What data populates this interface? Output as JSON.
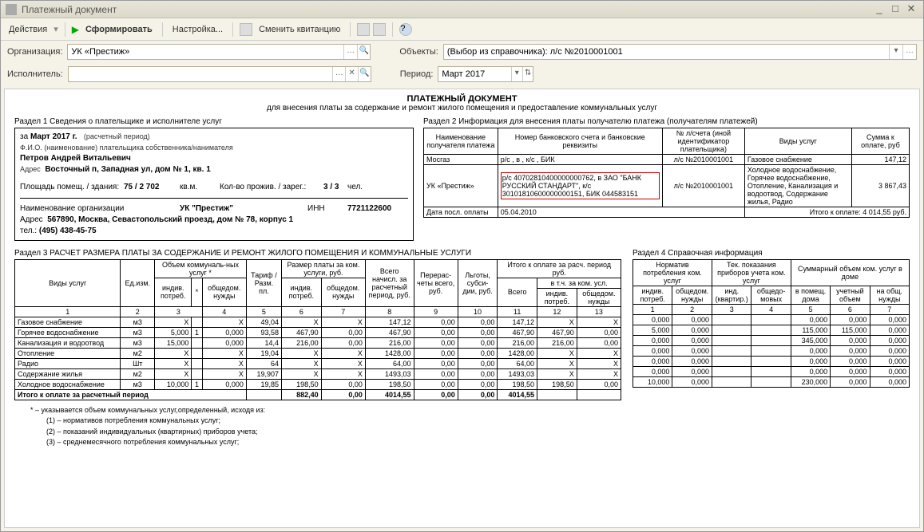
{
  "window": {
    "title": "Платежный документ"
  },
  "toolbar": {
    "actions": "Действия",
    "form": "Сформировать",
    "settings": "Настройка...",
    "change": "Сменить квитанцию"
  },
  "form": {
    "org_label": "Организация:",
    "org_value": "УК «Престиж»",
    "objects_label": "Объекты:",
    "objects_value": "(Выбор из справочника): л/с №2010001001",
    "exec_label": "Исполнитель:",
    "period_label": "Период:",
    "period_value": "Март 2017"
  },
  "doc": {
    "title": "ПЛАТЕЖНЫЙ ДОКУМЕНТ",
    "subtitle": "для внесения платы за содержание и ремонт жилого помещения и предоставление коммунальных услуг"
  },
  "s1": {
    "hdr": "Раздел 1    Сведения о плательщике и исполнителе услуг",
    "period_prefix": "за",
    "period": "Март 2017 г.",
    "period_note": "(расчетный период)",
    "fio_label": "Ф.И.О. (наименование) плательщика собственника/нанимателя",
    "fio": "Петров Андрей Витальевич",
    "addr_label": "Адрес",
    "addr": "Восточный п, Западная ул, дом № 1, кв. 1",
    "area_label": "Площадь помещ. / здания:",
    "area": "75 / 2 702",
    "area_unit": "кв.м.",
    "people_label": "Кол-во прожив. / зарег.:",
    "people": "3 / 3",
    "people_unit": "чел.",
    "org_label": "Наименование организации",
    "org": "УК \"Престиж\"",
    "inn_label": "ИНН",
    "inn": "7721122600",
    "org_addr_label": "Адрес",
    "org_addr": "567890, Москва, Севастопольский проезд, дом № 78, корпус 1",
    "tel_label": "тел.:",
    "tel": "(495) 438-45-75"
  },
  "s2": {
    "hdr": "Раздел 2    Информация для внесения платы получателю платежа (получателям платежей)",
    "cols": [
      "Наименование получателя платежа",
      "Номер банковского счета и банковские реквизиты",
      "№ л/счета (иной идентификатор плательщика)",
      "Виды услуг",
      "Сумма к оплате, руб"
    ],
    "rows": [
      {
        "name": "Мосгаз",
        "bank": "р/с , в , к/с , БИК",
        "acct": "л/с №2010001001",
        "svc": "Газовое снабжение",
        "sum": "147,12"
      },
      {
        "name": "УК «Престиж»",
        "bank": "р/с 40702810400000000762, в ЗАО \"БАНК РУССКИЙ СТАНДАРТ\", к/с 30101810600000000151, БИК 044583151",
        "acct": "л/с №2010001001",
        "svc": "Холодное водоснабжение, Горячее водоснабжение, Отопление, Канализация и водоотвод, Содержание жилья, Радио",
        "sum": "3 867,43"
      }
    ],
    "lastpay_label": "Дата посл. оплаты",
    "lastpay": "05.04.2010",
    "total_label": "Итого к оплате:",
    "total": "4 014,55 руб."
  },
  "s3": {
    "hdr": "Раздел 3    РАСЧЕТ РАЗМЕРА ПЛАТЫ ЗА СОДЕРЖАНИЕ И РЕМОНТ ЖИЛОГО ПОМЕЩЕНИЯ И КОММУНАЛЬНЫЕ УСЛУГИ",
    "head1": [
      "Виды услуг",
      "Ед.изм.",
      "Объем коммуналь-ных услуг *",
      "Тариф / Разм. пл.",
      "Размер платы за ком. услуги, руб.",
      "Всего начисл. за расчетный период, руб.",
      "Перерас-четы всего, руб.",
      "Льготы, субси-дии, руб.",
      "Итого к оплате за расч. период руб."
    ],
    "sub_vol": [
      "индив. потреб.",
      "*",
      "общедом. нужды"
    ],
    "sub_pay": [
      "индив. потреб.",
      "общедом. нужды"
    ],
    "sub_itogo": [
      "Всего",
      "в т.ч. за ком. усл."
    ],
    "sub_itogo2": [
      "индив. потреб.",
      "общедом. нужды"
    ],
    "nums": [
      "1",
      "2",
      "3",
      "4",
      "5",
      "6",
      "7",
      "8",
      "9",
      "10",
      "11",
      "12",
      "13"
    ],
    "rows": [
      [
        "Газовое снабжение",
        "м3",
        "X",
        "",
        "X",
        "49,04",
        "X",
        "X",
        "147,12",
        "0,00",
        "0,00",
        "147,12",
        "X",
        "X"
      ],
      [
        "Горячее водоснабжение",
        "м3",
        "5,000",
        "1",
        "0,000",
        "93,58",
        "467,90",
        "0,00",
        "467,90",
        "0,00",
        "0,00",
        "467,90",
        "467,90",
        "0,00"
      ],
      [
        "Канализация и водоотвод",
        "м3",
        "15,000",
        "",
        "0,000",
        "14,4",
        "216,00",
        "0,00",
        "216,00",
        "0,00",
        "0,00",
        "216,00",
        "216,00",
        "0,00"
      ],
      [
        "Отопление",
        "м2",
        "X",
        "",
        "X",
        "19,04",
        "X",
        "X",
        "1428,00",
        "0,00",
        "0,00",
        "1428,00",
        "X",
        "X"
      ],
      [
        "Радио",
        "Шт",
        "X",
        "",
        "X",
        "64",
        "X",
        "X",
        "64,00",
        "0,00",
        "0,00",
        "64,00",
        "X",
        "X"
      ],
      [
        "Содержание жилья",
        "м2",
        "X",
        "",
        "X",
        "19,907",
        "X",
        "X",
        "1493,03",
        "0,00",
        "0,00",
        "1493,03",
        "X",
        "X"
      ],
      [
        "Холодное водоснабжение",
        "м3",
        "10,000",
        "1",
        "0,000",
        "19,85",
        "198,50",
        "0,00",
        "198,50",
        "0,00",
        "0,00",
        "198,50",
        "198,50",
        "0,00"
      ]
    ],
    "total_row": [
      "Итого к оплате за расчетный период",
      "",
      "",
      "",
      "",
      "882,40",
      "0,00",
      "4014,55",
      "0,00",
      "0,00",
      "4014,55",
      "",
      ""
    ]
  },
  "s4": {
    "hdr": "Раздел 4    Справочная информация",
    "head1": [
      "Норматив потребления ком. услуг",
      "Тек. показания приборов учета ком. услуг",
      "Суммарный объем ком. услуг в доме"
    ],
    "sub1": [
      "индив. потреб.",
      "общедом. нужды",
      "инд. (квартир.)",
      "общедо-мовых",
      "в помещ. дома",
      "учетный объем",
      "на общ. нужды"
    ],
    "nums": [
      "1",
      "2",
      "3",
      "4",
      "5",
      "6",
      "7"
    ],
    "rows": [
      [
        "0,000",
        "0,000",
        "",
        "",
        "0,000",
        "0,000",
        "0,000"
      ],
      [
        "5,000",
        "0,000",
        "",
        "",
        "115,000",
        "115,000",
        "0,000"
      ],
      [
        "0,000",
        "0,000",
        "",
        "",
        "345,000",
        "0,000",
        "0,000"
      ],
      [
        "0,000",
        "0,000",
        "",
        "",
        "0,000",
        "0,000",
        "0,000"
      ],
      [
        "0,000",
        "0,000",
        "",
        "",
        "0,000",
        "0,000",
        "0,000"
      ],
      [
        "0,000",
        "0,000",
        "",
        "",
        "0,000",
        "0,000",
        "0,000"
      ],
      [
        "10,000",
        "0,000",
        "",
        "",
        "230,000",
        "0,000",
        "0,000"
      ]
    ]
  },
  "notes": {
    "intro": "* – указывается объем коммунальных услуг,определенный, исходя из:",
    "n1": "(1) – нормативов потребления коммунальных услуг;",
    "n2": "(2) – показаний индивидуальных (квартирных) приборов учета;",
    "n3": "(3) – среднемесячного потребления коммунальных услуг;"
  }
}
